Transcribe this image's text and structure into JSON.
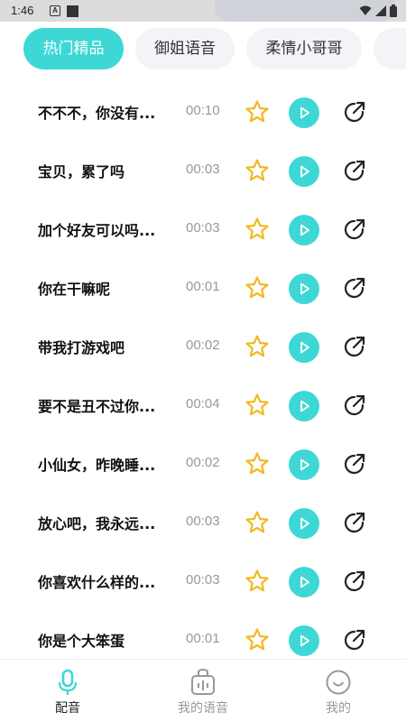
{
  "status_bar": {
    "time": "1:46",
    "notification_icons": [
      "a-badge-icon",
      "square-icon"
    ],
    "right_icons": [
      "wifi-icon",
      "signal-icon",
      "battery-icon"
    ]
  },
  "tabs": [
    {
      "label": "热门精品",
      "active": true
    },
    {
      "label": "御姐语音",
      "active": false
    },
    {
      "label": "柔情小哥哥",
      "active": false
    },
    {
      "label": "",
      "active": false
    }
  ],
  "items": [
    {
      "title": "不不不，你没有...",
      "duration": "00:10"
    },
    {
      "title": "宝贝，累了吗",
      "duration": "00:03"
    },
    {
      "title": "加个好友可以吗...",
      "duration": "00:03"
    },
    {
      "title": "你在干嘛呢",
      "duration": "00:01"
    },
    {
      "title": "带我打游戏吧",
      "duration": "00:02"
    },
    {
      "title": "要不是丑不过你...",
      "duration": "00:04"
    },
    {
      "title": "小仙女，昨晚睡...",
      "duration": "00:02"
    },
    {
      "title": "放心吧，我永远...",
      "duration": "00:03"
    },
    {
      "title": "你喜欢什么样的...",
      "duration": "00:03"
    },
    {
      "title": "你是个大笨蛋",
      "duration": "00:01"
    }
  ],
  "bottom_nav": [
    {
      "label": "配音",
      "icon": "microphone-icon",
      "active": true
    },
    {
      "label": "我的语音",
      "icon": "voice-bag-icon",
      "active": false
    },
    {
      "label": "我的",
      "icon": "smile-icon",
      "active": false
    }
  ],
  "colors": {
    "accent": "#3dd8d5",
    "star": "#f5b720",
    "text": "#111111",
    "muted": "#999999",
    "tab_bg": "#f2f4f8"
  }
}
